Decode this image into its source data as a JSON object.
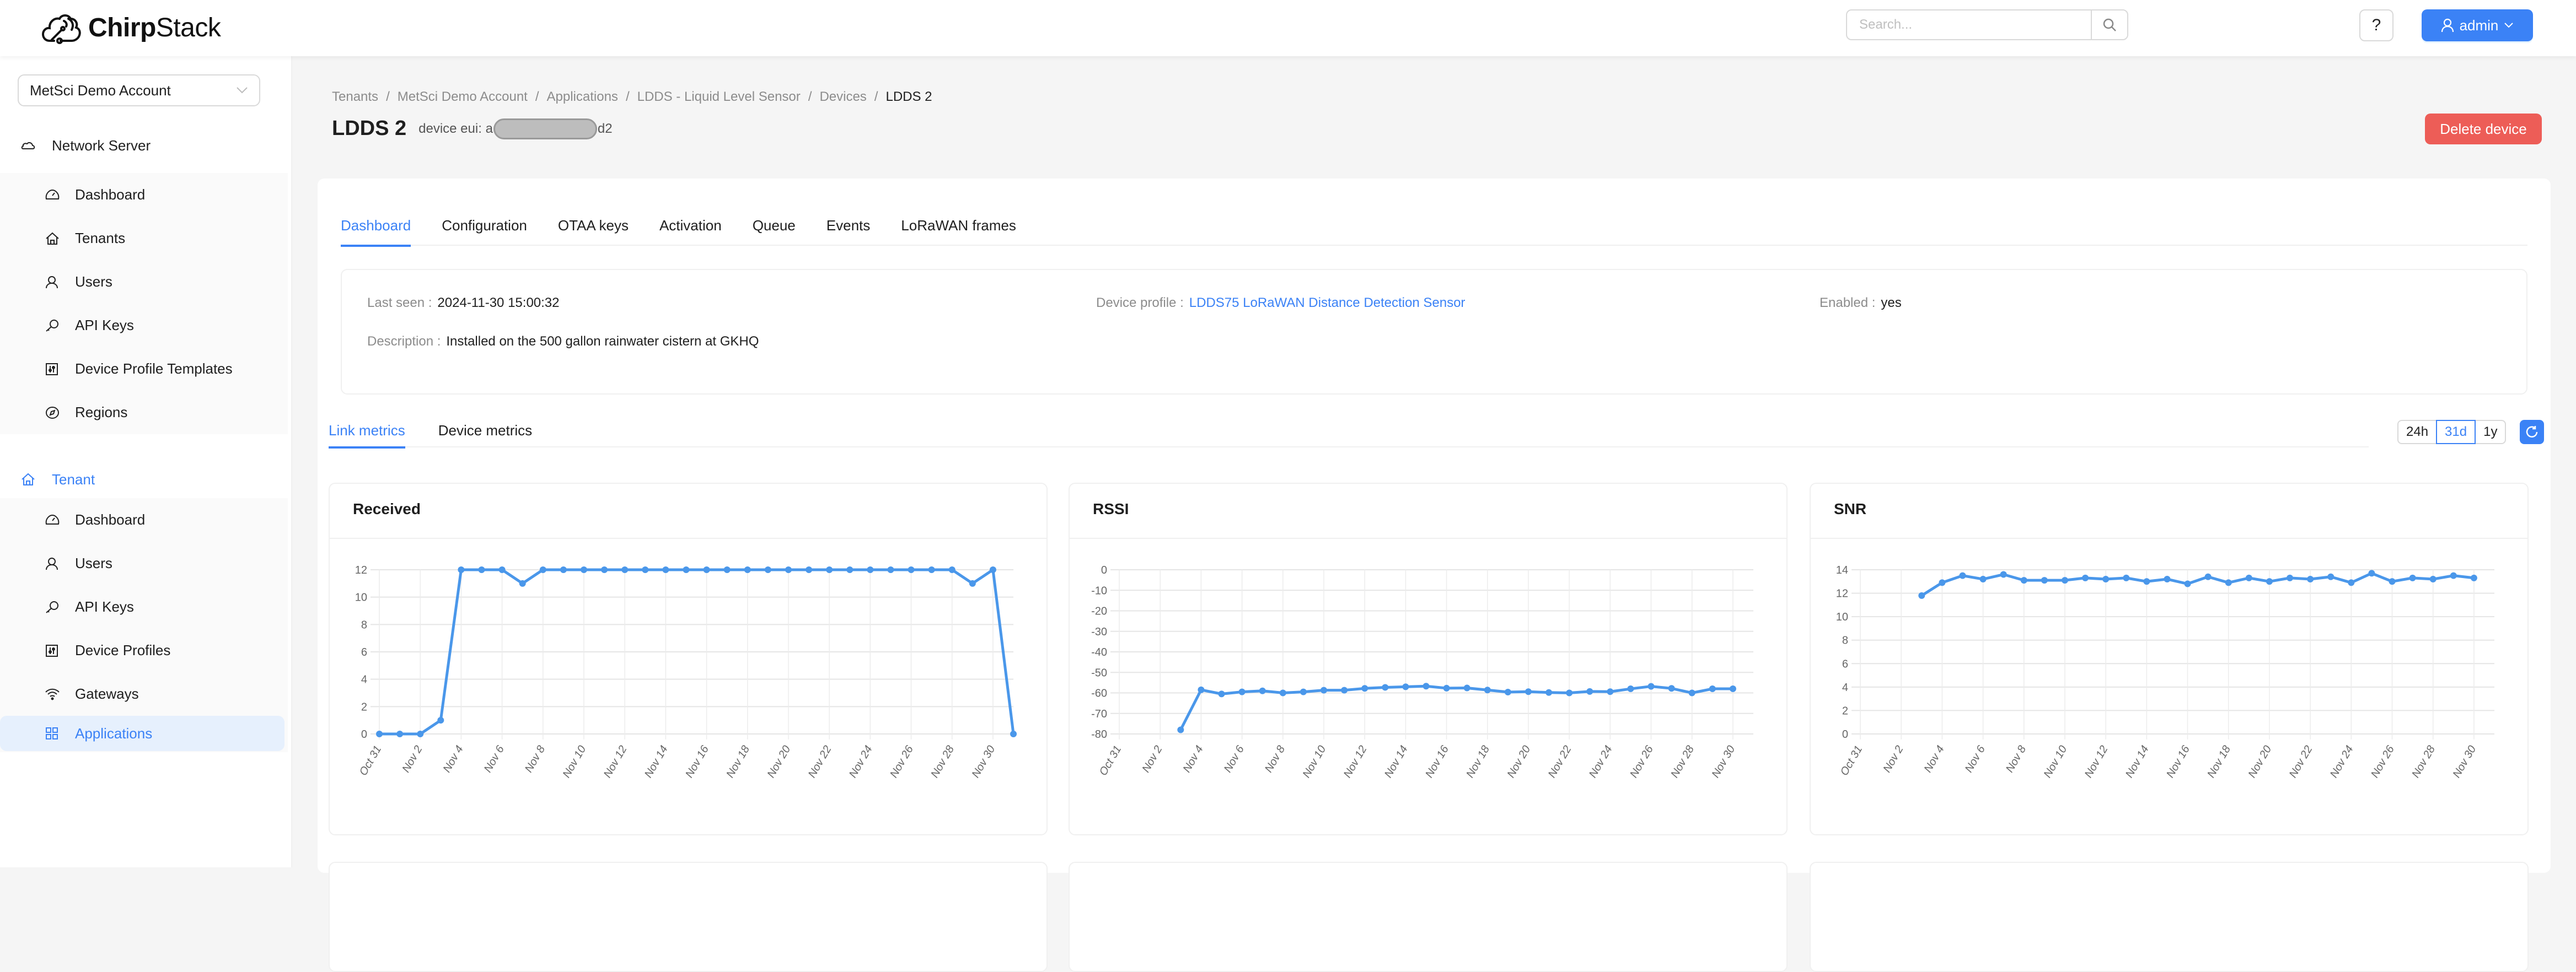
{
  "header": {
    "brand_bold": "Chirp",
    "brand_light": "Stack",
    "search_placeholder": "Search...",
    "search_value": "",
    "help_label": "?",
    "user_label": "admin"
  },
  "sidebar": {
    "tenant_select": "MetSci Demo Account",
    "network_server": {
      "label": "Network Server",
      "items": [
        {
          "label": "Dashboard",
          "icon": "dashboard-icon"
        },
        {
          "label": "Tenants",
          "icon": "home-icon"
        },
        {
          "label": "Users",
          "icon": "user-icon"
        },
        {
          "label": "API Keys",
          "icon": "key-icon"
        },
        {
          "label": "Device Profile Templates",
          "icon": "sliders-icon"
        },
        {
          "label": "Regions",
          "icon": "compass-icon"
        }
      ]
    },
    "tenant": {
      "label": "Tenant",
      "items": [
        {
          "label": "Dashboard",
          "icon": "dashboard-icon"
        },
        {
          "label": "Users",
          "icon": "user-icon"
        },
        {
          "label": "API Keys",
          "icon": "key-icon"
        },
        {
          "label": "Device Profiles",
          "icon": "sliders-icon"
        },
        {
          "label": "Gateways",
          "icon": "wifi-icon"
        },
        {
          "label": "Applications",
          "icon": "grid-icon",
          "active": true
        }
      ]
    }
  },
  "breadcrumb": [
    "Tenants",
    "MetSci Demo Account",
    "Applications",
    "LDDS - Liquid Level Sensor",
    "Devices",
    "LDDS 2"
  ],
  "page": {
    "title": "LDDS 2",
    "eui_label": "device eui:",
    "eui_prefix": "a",
    "eui_suffix": "d2",
    "delete_label": "Delete device"
  },
  "tabs": [
    "Dashboard",
    "Configuration",
    "OTAA keys",
    "Activation",
    "Queue",
    "Events",
    "LoRaWAN frames"
  ],
  "active_tab": "Dashboard",
  "details": {
    "last_seen_label": "Last seen",
    "last_seen": "2024-11-30 15:00:32",
    "device_profile_label": "Device profile",
    "device_profile": "LDDS75 LoRaWAN Distance Detection Sensor",
    "enabled_label": "Enabled",
    "enabled": "yes",
    "description_label": "Description",
    "description": "Installed on the 500 gallon rainwater cistern at GKHQ"
  },
  "metric_tabs": [
    "Link metrics",
    "Device metrics"
  ],
  "range": {
    "options": [
      "24h",
      "31d",
      "1y"
    ],
    "selected": "31d"
  },
  "colors": {
    "accent": "#3b82f6",
    "danger": "#ed5d57",
    "series": "#4a97ea"
  },
  "chart_data": [
    {
      "type": "line",
      "title": "Received",
      "xlabel": "",
      "ylabel": "",
      "ylim": [
        0,
        12
      ],
      "yticks": [
        0,
        2,
        4,
        6,
        8,
        10,
        12
      ],
      "xtick_labels": [
        "Oct 31",
        "Nov 2",
        "Nov 4",
        "Nov 6",
        "Nov 8",
        "Nov 10",
        "Nov 12",
        "Nov 14",
        "Nov 16",
        "Nov 18",
        "Nov 20",
        "Nov 22",
        "Nov 24",
        "Nov 26",
        "Nov 28",
        "Nov 30"
      ],
      "x": [
        "Oct 31",
        "Nov 1",
        "Nov 2",
        "Nov 3",
        "Nov 4",
        "Nov 5",
        "Nov 6",
        "Nov 7",
        "Nov 8",
        "Nov 9",
        "Nov 10",
        "Nov 11",
        "Nov 12",
        "Nov 13",
        "Nov 14",
        "Nov 15",
        "Nov 16",
        "Nov 17",
        "Nov 18",
        "Nov 19",
        "Nov 20",
        "Nov 21",
        "Nov 22",
        "Nov 23",
        "Nov 24",
        "Nov 25",
        "Nov 26",
        "Nov 27",
        "Nov 28",
        "Nov 29",
        "Nov 30",
        "Dec 1"
      ],
      "values": [
        0,
        0,
        0,
        1,
        12,
        12,
        12,
        11,
        12,
        12,
        12,
        12,
        12,
        12,
        12,
        12,
        12,
        12,
        12,
        12,
        12,
        12,
        12,
        12,
        12,
        12,
        12,
        12,
        12,
        11,
        12,
        0
      ],
      "x_start_index": 0,
      "grid": true
    },
    {
      "type": "line",
      "title": "RSSI",
      "xlabel": "",
      "ylabel": "",
      "ylim": [
        -80,
        0
      ],
      "yticks": [
        0,
        -10,
        -20,
        -30,
        -40,
        -50,
        -60,
        -70,
        -80
      ],
      "xtick_labels": [
        "Oct 31",
        "Nov 2",
        "Nov 4",
        "Nov 6",
        "Nov 8",
        "Nov 10",
        "Nov 12",
        "Nov 14",
        "Nov 16",
        "Nov 18",
        "Nov 20",
        "Nov 22",
        "Nov 24",
        "Nov 26",
        "Nov 28",
        "Nov 30"
      ],
      "x": [
        "Nov 3",
        "Nov 4",
        "Nov 5",
        "Nov 6",
        "Nov 7",
        "Nov 8",
        "Nov 9",
        "Nov 10",
        "Nov 11",
        "Nov 12",
        "Nov 13",
        "Nov 14",
        "Nov 15",
        "Nov 16",
        "Nov 17",
        "Nov 18",
        "Nov 19",
        "Nov 20",
        "Nov 21",
        "Nov 22",
        "Nov 23",
        "Nov 24",
        "Nov 25",
        "Nov 26",
        "Nov 27",
        "Nov 28",
        "Nov 29",
        "Nov 30"
      ],
      "values": [
        -78,
        -58.5,
        -60.5,
        -59.5,
        -59,
        -60,
        -59.5,
        -58.7,
        -58.7,
        -57.8,
        -57.3,
        -57,
        -56.7,
        -57.7,
        -57.6,
        -58.6,
        -59.6,
        -59.4,
        -59.8,
        -60,
        -59.3,
        -59.4,
        -58,
        -56.8,
        -57.8,
        -60,
        -58,
        -58
      ],
      "x_start_index": 3,
      "grid": true
    },
    {
      "type": "line",
      "title": "SNR",
      "xlabel": "",
      "ylabel": "",
      "ylim": [
        0,
        14
      ],
      "yticks": [
        0,
        2,
        4,
        6,
        8,
        10,
        12,
        14
      ],
      "xtick_labels": [
        "Oct 31",
        "Nov 2",
        "Nov 4",
        "Nov 6",
        "Nov 8",
        "Nov 10",
        "Nov 12",
        "Nov 14",
        "Nov 16",
        "Nov 18",
        "Nov 20",
        "Nov 22",
        "Nov 24",
        "Nov 26",
        "Nov 28",
        "Nov 30"
      ],
      "x": [
        "Nov 3",
        "Nov 4",
        "Nov 5",
        "Nov 6",
        "Nov 7",
        "Nov 8",
        "Nov 9",
        "Nov 10",
        "Nov 11",
        "Nov 12",
        "Nov 13",
        "Nov 14",
        "Nov 15",
        "Nov 16",
        "Nov 17",
        "Nov 18",
        "Nov 19",
        "Nov 20",
        "Nov 21",
        "Nov 22",
        "Nov 23",
        "Nov 24",
        "Nov 25",
        "Nov 26",
        "Nov 27",
        "Nov 28",
        "Nov 29",
        "Nov 30"
      ],
      "values": [
        11.8,
        12.9,
        13.5,
        13.2,
        13.6,
        13.1,
        13.1,
        13.1,
        13.3,
        13.2,
        13.3,
        13.0,
        13.2,
        12.8,
        13.4,
        12.9,
        13.3,
        13.0,
        13.3,
        13.2,
        13.4,
        12.9,
        13.7,
        13.0,
        13.3,
        13.2,
        13.5,
        13.3
      ],
      "x_start_index": 3,
      "grid": true
    }
  ]
}
